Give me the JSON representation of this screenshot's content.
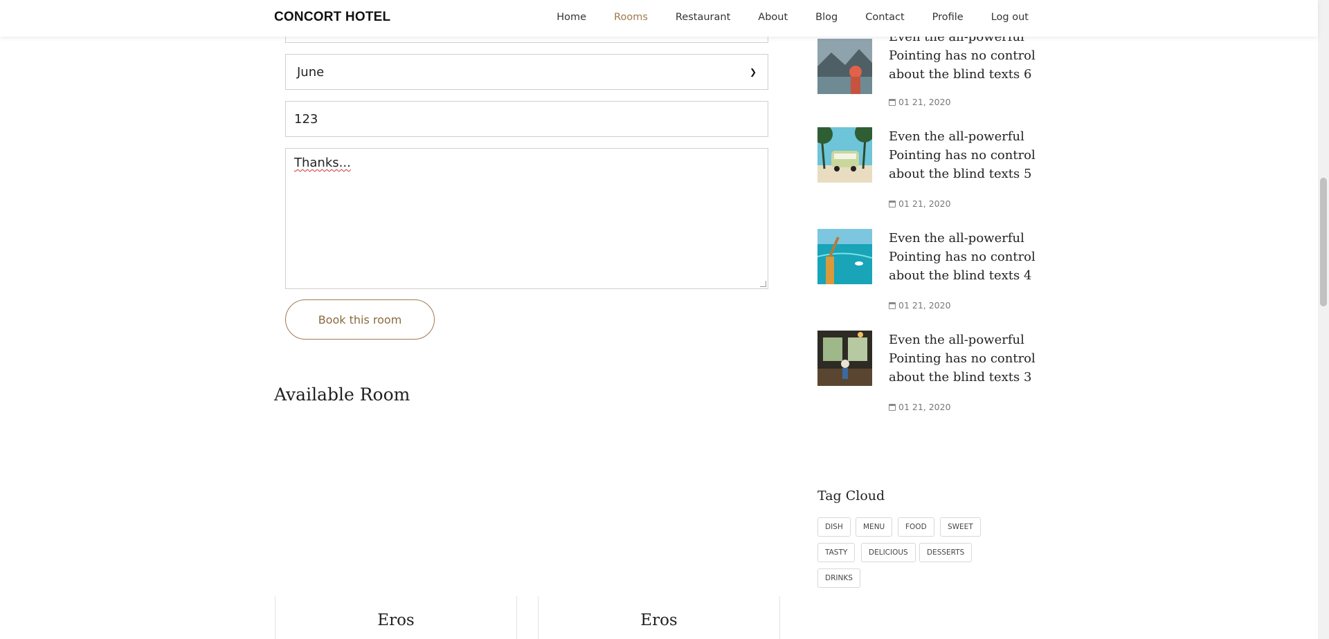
{
  "nav": {
    "brand": "CONCORT HOTEL",
    "items": [
      {
        "label": "Home"
      },
      {
        "label": "Rooms"
      },
      {
        "label": "Restaurant"
      },
      {
        "label": "About"
      },
      {
        "label": "Blog"
      },
      {
        "label": "Contact"
      },
      {
        "label": "Profile"
      },
      {
        "label": "Log out"
      }
    ],
    "active": "Rooms",
    "active_color": "#9c7a4e"
  },
  "form": {
    "month_value": "June",
    "number_value": "123",
    "message_value": "Thanks...",
    "submit_label": "Book this room"
  },
  "available": {
    "title": "Available Room",
    "rooms": [
      {
        "name": "Eros"
      },
      {
        "name": "Eros"
      }
    ]
  },
  "sidebar": {
    "posts": [
      {
        "title": "Even the all-powerful Pointing has no control about the blind texts 6",
        "date": "01 21, 2020",
        "image": "mountain-lake-traveler"
      },
      {
        "title": "Even the all-powerful Pointing has no control about the blind texts 5",
        "date": "01 21, 2020",
        "image": "beach-van-palms"
      },
      {
        "title": "Even the all-powerful Pointing has no control about the blind texts 4",
        "date": "01 21, 2020",
        "image": "sea-swimmer"
      },
      {
        "title": "Even the all-powerful Pointing has no control about the blind texts 3",
        "date": "01 21, 2020",
        "image": "cafe-interior"
      }
    ],
    "tag_cloud_title": "Tag Cloud",
    "tags": [
      "DISH",
      "MENU",
      "FOOD",
      "SWEET",
      "TASTY",
      "DELICIOUS",
      "DESSERTS",
      "DRINKS"
    ]
  }
}
